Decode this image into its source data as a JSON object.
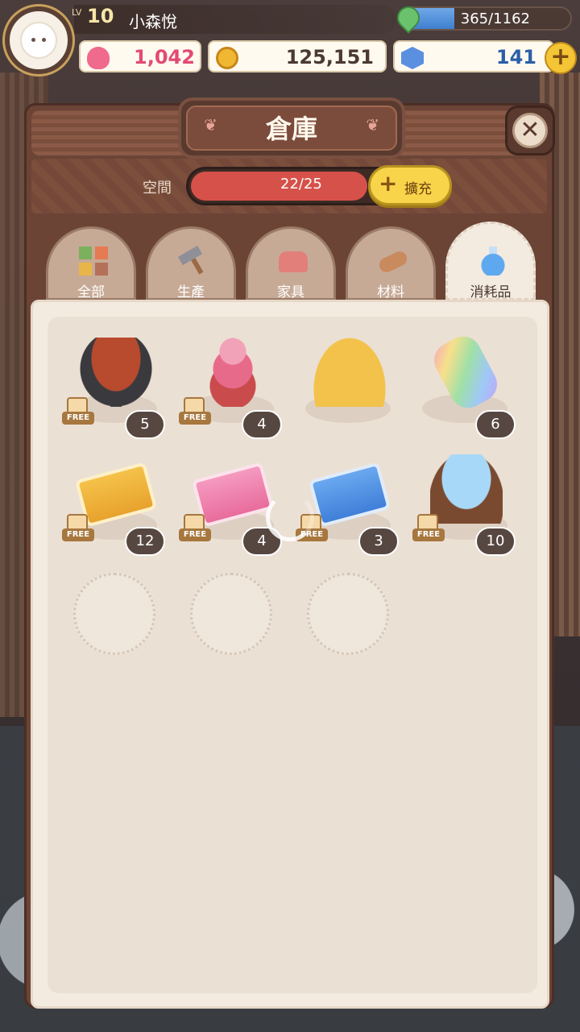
{
  "player": {
    "lv_tag": "LV",
    "level": "10",
    "name": "小森悅",
    "energy_text": "365/1162",
    "energy_fraction": 0.314
  },
  "resources": {
    "hearts": "1,042",
    "gold": "125,151",
    "gems": "141",
    "add_label": "+"
  },
  "panel": {
    "title": "倉庫",
    "close_label": "✕",
    "capacity_label": "空間",
    "capacity_text": "22/25",
    "capacity_fraction": 0.88,
    "expand_plus": "+",
    "expand_label": "擴充"
  },
  "tabs": [
    {
      "label": "全部",
      "icon": "grid-icon"
    },
    {
      "label": "生產",
      "icon": "hammer-icon"
    },
    {
      "label": "家具",
      "icon": "sofa-icon"
    },
    {
      "label": "材料",
      "icon": "log-icon"
    },
    {
      "label": "消耗品",
      "icon": "potion-icon",
      "active": true
    }
  ],
  "free_label": "FREE",
  "items": [
    {
      "icon": "bbq-grill-icon",
      "count": "5",
      "free": true
    },
    {
      "icon": "dessert-stand-icon",
      "count": "4",
      "free": true
    },
    {
      "icon": "strawberry-cake-icon",
      "count": "",
      "free": false
    },
    {
      "icon": "rainbow-bottle-icon",
      "count": "6",
      "free": false
    },
    {
      "icon": "gold-ticket-icon",
      "count": "12",
      "free": true
    },
    {
      "icon": "heart-ticket-icon",
      "count": "4",
      "free": true
    },
    {
      "icon": "gem-ticket-icon",
      "count": "3",
      "free": true
    },
    {
      "icon": "crystal-bowl-icon",
      "count": "10",
      "free": true
    }
  ],
  "colors": {
    "heart": "#e24a73",
    "gem": "#2c5ea8",
    "capacity_fill": "#d65149",
    "expand_button": "#f7d44a"
  }
}
